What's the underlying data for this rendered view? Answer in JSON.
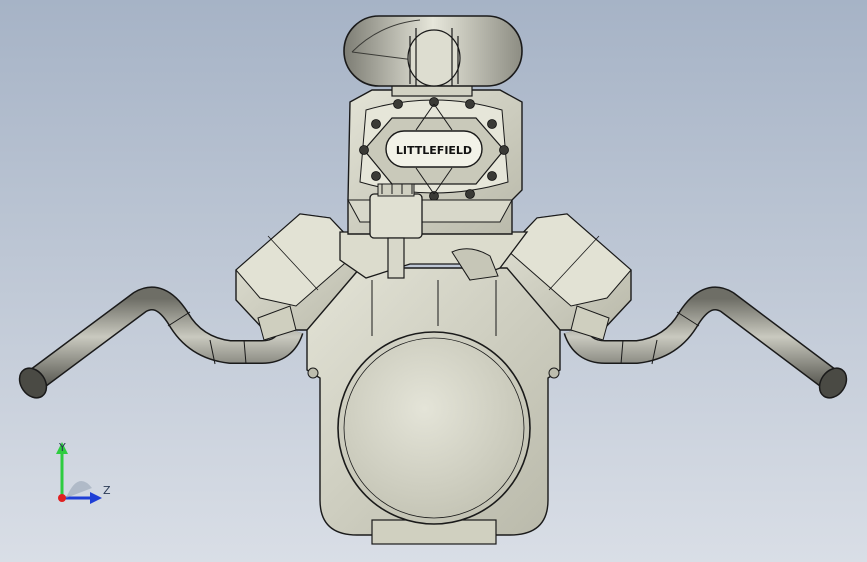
{
  "viewport": {
    "background_top": "#a6b3c6",
    "background_bottom": "#d9dee6"
  },
  "model": {
    "brand_label": "LITTLEFIELD",
    "body_color": "#d6d6c6",
    "pipe_color": "#8a8a80",
    "outline_color": "#1a1a1a"
  },
  "triad": {
    "y_label": "Y",
    "z_label": "Z",
    "y_color": "#2ecc40",
    "z_color": "#1f3fd6",
    "origin_color": "#e02020"
  }
}
